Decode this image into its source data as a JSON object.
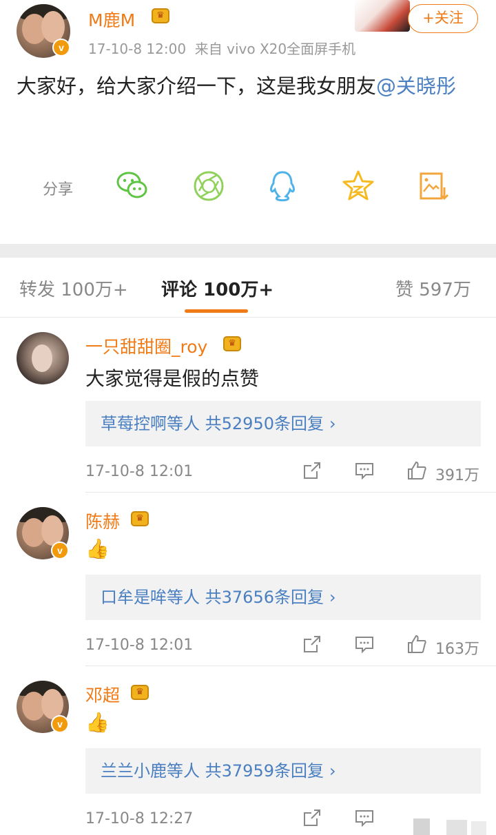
{
  "post": {
    "username": "M鹿M",
    "crown": "♛",
    "verified": "v",
    "time": "17-10-8 12:00",
    "source": "来自 vivo X20全面屏手机",
    "text_main": "大家好，给大家介绍一下，这是我女朋友",
    "mention": "@关晓彤",
    "follow_label": "+关注"
  },
  "share": {
    "label": "分享",
    "icons": [
      "wechat-icon",
      "moments-icon",
      "qq-icon",
      "qzone-icon",
      "save-image-icon"
    ]
  },
  "tabs": {
    "repost": "转发 100万+",
    "comment": "评论 100万+",
    "like": "赞 597万"
  },
  "comments": [
    {
      "name": "一只甜甜圈_roy",
      "text": "大家觉得是假的点赞",
      "reply_users": "草莓控啊等人",
      "reply_count": "共52950条回复",
      "time": "17-10-8 12:01",
      "likes": "391万"
    },
    {
      "name": "陈赫",
      "text": "👍",
      "reply_users": "口牟是哞等人",
      "reply_count": "共37656条回复",
      "time": "17-10-8 12:01",
      "likes": "163万"
    },
    {
      "name": "邓超",
      "text": "👍",
      "reply_users": "兰兰小鹿等人",
      "reply_count": "共37959条回复",
      "time": "17-10-8 12:27",
      "likes": ""
    }
  ],
  "colors": {
    "accent": "#f07a16",
    "link": "#4a7fc1",
    "muted": "#888888"
  }
}
